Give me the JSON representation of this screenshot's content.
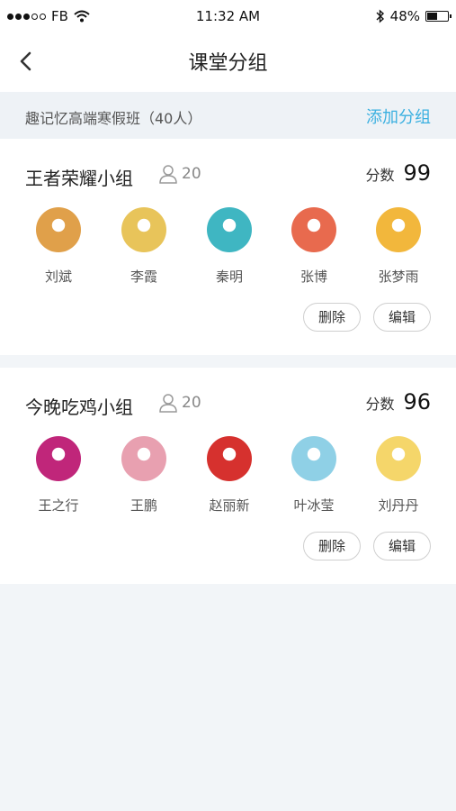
{
  "status_bar": {
    "carrier": "FB",
    "time": "11:32 AM",
    "battery": "48%",
    "battery_level": 0.48
  },
  "nav": {
    "title": "课堂分组"
  },
  "class_bar": {
    "class_name": "趣记忆高端寒假班（40人）",
    "add_group": "添加分组"
  },
  "groups": [
    {
      "name": "王者荣耀小组",
      "count": "20",
      "score_label": "分数",
      "score": "99",
      "members": [
        {
          "name": "刘斌",
          "color": "#e0a04a"
        },
        {
          "name": "李霞",
          "color": "#e8c45a"
        },
        {
          "name": "秦明",
          "color": "#3fb6c2"
        },
        {
          "name": "张博",
          "color": "#e86a4e"
        },
        {
          "name": "张梦雨",
          "color": "#f2b73c"
        }
      ],
      "delete_label": "删除",
      "edit_label": "编辑"
    },
    {
      "name": "今晚吃鸡小组",
      "count": "20",
      "score_label": "分数",
      "score": "96",
      "members": [
        {
          "name": "王之行",
          "color": "#c0267a"
        },
        {
          "name": "王鹏",
          "color": "#e8a0b0"
        },
        {
          "name": "赵丽新",
          "color": "#d6312e"
        },
        {
          "name": "叶冰莹",
          "color": "#8fd0e6"
        },
        {
          "name": "刘丹丹",
          "color": "#f5d66a"
        }
      ],
      "delete_label": "删除",
      "edit_label": "编辑"
    }
  ]
}
